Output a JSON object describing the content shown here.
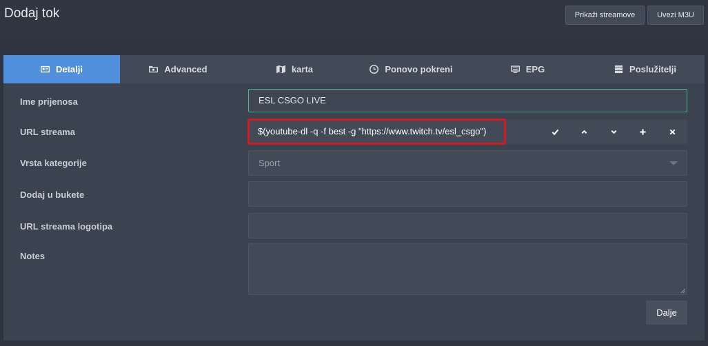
{
  "header": {
    "title": "Dodaj tok",
    "show_streams_label": "Prikaži streamove",
    "import_m3u_label": "Uvezi M3U"
  },
  "tabs": [
    {
      "label": "Detalji",
      "icon": "id-card-icon",
      "active": true
    },
    {
      "label": "Advanced",
      "icon": "folder-cog-icon",
      "active": false
    },
    {
      "label": "karta",
      "icon": "map-icon",
      "active": false
    },
    {
      "label": "Ponovo pokreni",
      "icon": "clock-icon",
      "active": false
    },
    {
      "label": "EPG",
      "icon": "tv-guide-icon",
      "active": false
    },
    {
      "label": "Poslužitelji",
      "icon": "server-icon",
      "active": false
    }
  ],
  "form": {
    "name": {
      "label": "Ime prijenosa",
      "value": "ESL CSGO LIVE"
    },
    "url": {
      "label": "URL streama",
      "value": "$(youtube-dl -q -f best -g \"https://www.twitch.tv/esl_csgo\")",
      "actions": [
        "check-icon",
        "chevron-up-icon",
        "chevron-down-icon",
        "plus-icon",
        "close-icon"
      ]
    },
    "category": {
      "label": "Vrsta kategorije",
      "value": "Sport"
    },
    "bouquets": {
      "label": "Dodaj u bukete",
      "value": ""
    },
    "logo": {
      "label": "URL streama logotipa",
      "value": ""
    },
    "notes": {
      "label": "Notes",
      "value": ""
    }
  },
  "footer": {
    "next_label": "Dalje"
  },
  "colors": {
    "accent": "#4f8fdb",
    "highlight": "#d7191f",
    "focus": "#4fb48f"
  }
}
